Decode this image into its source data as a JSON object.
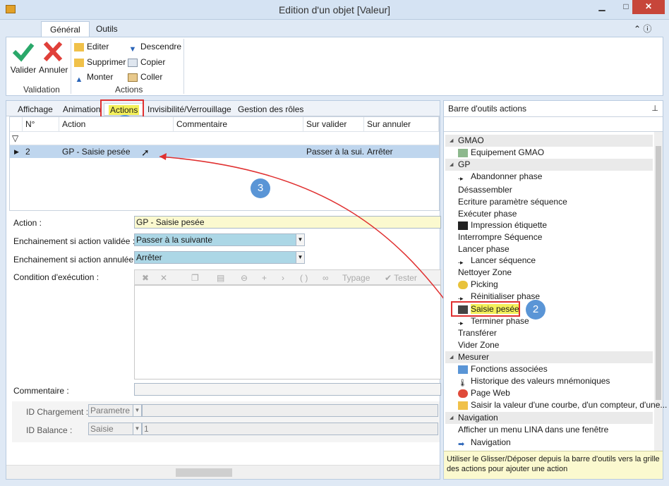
{
  "window": {
    "title": "Edition d'un objet [Valeur]",
    "minimize": "▁",
    "maximize": "□",
    "close": "✕"
  },
  "ribbon": {
    "tabs": [
      "Général",
      "Outils"
    ],
    "validation": {
      "valider": "Valider",
      "annuler": "Annuler",
      "group": "Validation"
    },
    "actions": {
      "editer": "Editer",
      "supprimer": "Supprimer",
      "monter": "Monter",
      "descendre": "Descendre",
      "copier": "Copier",
      "coller": "Coller",
      "group": "Actions"
    }
  },
  "subtabs": [
    "Affichage",
    "Animation",
    "Actions",
    "Invisibilité/Verrouillage",
    "Gestion des rôles"
  ],
  "badges": [
    "1",
    "2",
    "3"
  ],
  "grid": {
    "headers": [
      "N°",
      "Action",
      "Commentaire",
      "Sur valider",
      "Sur annuler"
    ],
    "row": {
      "n": "2",
      "action": "GP - Saisie pesée",
      "comment": "",
      "valider": "Passer à la sui...",
      "annuler": "Arrêter"
    }
  },
  "form": {
    "action_label": "Action :",
    "action_value": "GP - Saisie pesée",
    "ench_val_label": "Enchainement si action validée :",
    "ench_val_value": "Passer à la suivante",
    "ench_ann_label": "Enchainement si action annulée :",
    "ench_ann_value": "Arrêter",
    "cond_label": "Condition d'exécution :",
    "typage": "Typage",
    "tester": "Tester",
    "comment_label": "Commentaire :",
    "idc_label": "ID Chargement :",
    "idc_value": "Parametre",
    "idb_label": "ID Balance :",
    "idb_value": "Saisie",
    "idb_num": "1"
  },
  "right": {
    "title": "Barre d'outils actions",
    "cats": [
      "GMAO",
      "GP",
      "Mesurer",
      "Navigation"
    ],
    "gmao": [
      "Equipement GMAO"
    ],
    "gp": [
      "Abandonner phase",
      "Désassembler",
      "Ecriture paramètre séquence",
      "Exécuter phase",
      "Impression étiquette",
      "Interrompre Séquence",
      "Lancer phase",
      "Lancer séquence",
      "Nettoyer Zone",
      "Picking",
      "Réinitialiser phase",
      "Saisie pesée",
      "Terminer phase",
      "Transférer",
      "Vider Zone"
    ],
    "mesurer": [
      "Fonctions associées",
      "Historique des valeurs mnémoniques",
      "Page Web",
      "Saisir la valeur d'une courbe, d'un compteur, d'une..."
    ],
    "navigation": [
      "Afficher un menu LINA dans une fenêtre",
      "Navigation"
    ],
    "hint": "Utiliser le Glisser/Déposer depuis la barre d'outils vers la grille des actions pour ajouter une action"
  },
  "colors": {
    "accent": "#5a95d6",
    "highlight": "#f3f05a",
    "red": "#e03030"
  }
}
